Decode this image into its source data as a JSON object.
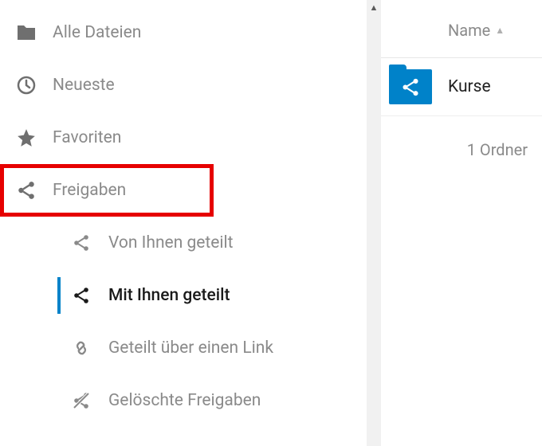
{
  "sidebar": {
    "items": [
      {
        "label": "Alle Dateien"
      },
      {
        "label": "Neueste"
      },
      {
        "label": "Favoriten"
      },
      {
        "label": "Freigaben"
      }
    ],
    "sub_items": [
      {
        "label": "Von Ihnen geteilt"
      },
      {
        "label": "Mit Ihnen geteilt"
      },
      {
        "label": "Geteilt über einen Link"
      },
      {
        "label": "Gelöschte Freigaben"
      }
    ],
    "active_sub_index": 1,
    "highlight_index": 3
  },
  "main": {
    "column_header": "Name",
    "rows": [
      {
        "name": "Kurse"
      }
    ],
    "summary": "1 Ordner"
  },
  "colors": {
    "accent": "#0082c9",
    "highlight": "#e60000"
  }
}
